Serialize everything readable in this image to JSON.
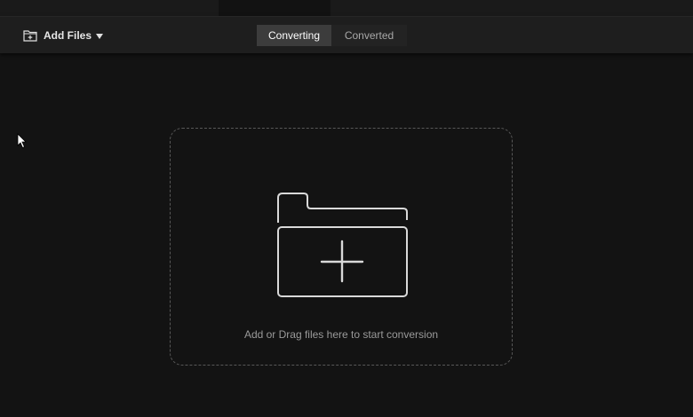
{
  "toolbar": {
    "add_files_label": "Add Files",
    "add_files_icon": "folder-plus-icon",
    "dropdown_icon": "caret-down-icon"
  },
  "tabs": [
    {
      "label": "Converting",
      "active": true
    },
    {
      "label": "Converted",
      "active": false
    }
  ],
  "drop_zone": {
    "icon": "folder-add-icon",
    "text": "Add or Drag files here to start conversion"
  },
  "colors": {
    "background": "#131313",
    "toolbar": "#1e1e1e",
    "active_tab": "#3c3c3c",
    "inactive_tab": "#232323",
    "dashed_border": "#585858",
    "icon_stroke": "#d9d9d9"
  }
}
